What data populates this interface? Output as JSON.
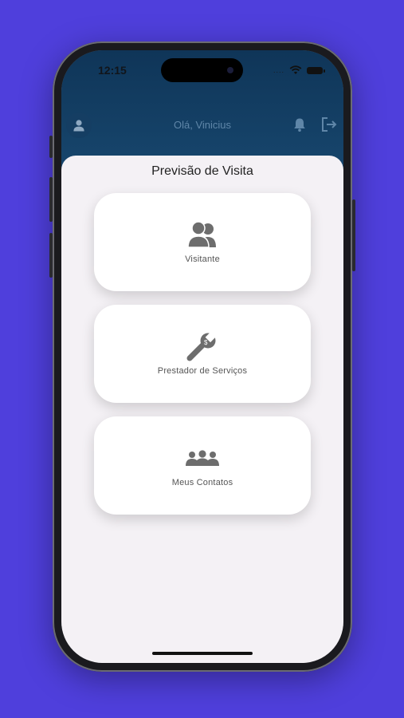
{
  "status_bar": {
    "time": "12:15",
    "signal": "...."
  },
  "header": {
    "greeting": "Olá, Vinicius"
  },
  "sheet": {
    "title": "Previsão de Visita",
    "cards": [
      {
        "label": "Visitante",
        "icon": "users-icon"
      },
      {
        "label": "Prestador de Serviços",
        "icon": "wrench-icon"
      },
      {
        "label": "Meus Contatos",
        "icon": "group-icon"
      }
    ]
  },
  "colors": {
    "background": "#4f3fdc",
    "header": "#15426a",
    "sheet": "#f4f1f5",
    "card": "#ffffff",
    "icon": "#6d6d6d"
  }
}
